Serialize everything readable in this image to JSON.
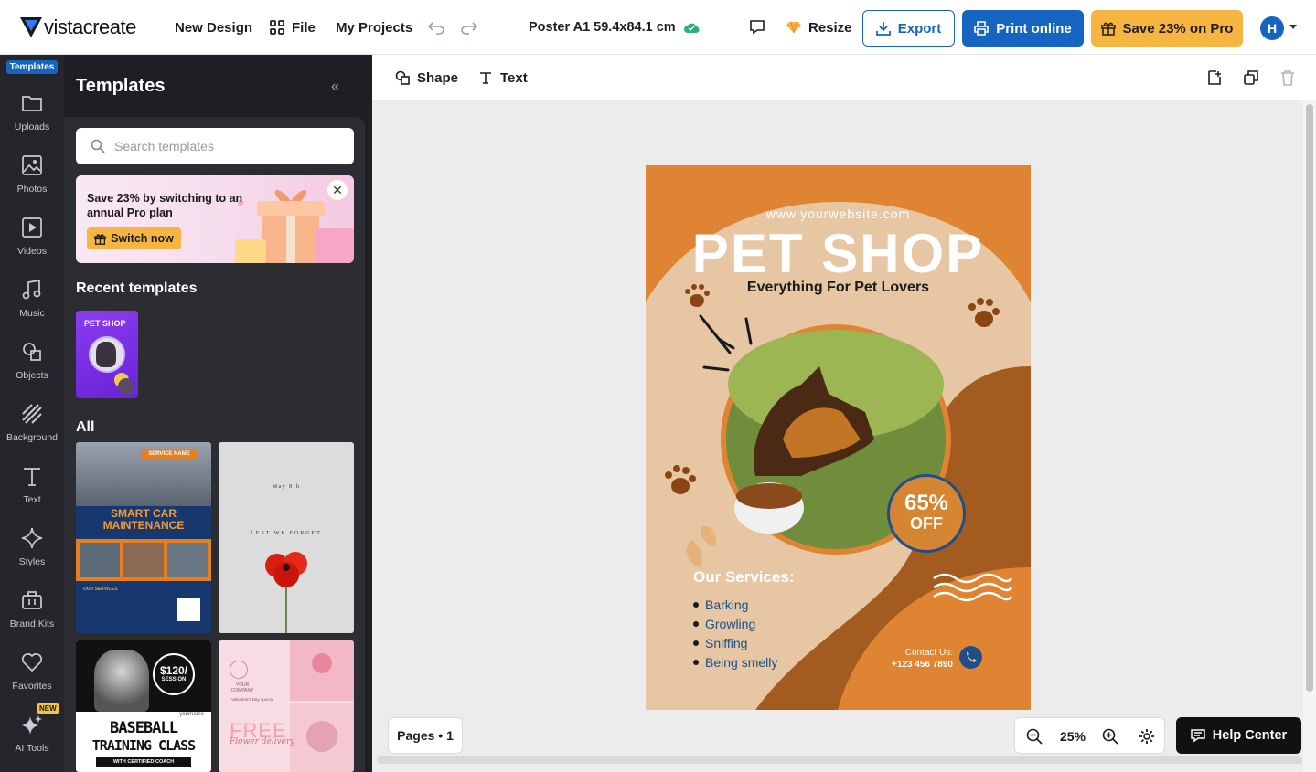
{
  "topbar": {
    "logo_text": "vistacreate",
    "new_design": "New Design",
    "file": "File",
    "my_projects": "My Projects",
    "doc_title": "Poster A1 59.4x84.1 cm",
    "resize": "Resize",
    "export": "Export",
    "print_online": "Print online",
    "save_pro": "Save 23% on Pro",
    "avatar_initial": "H"
  },
  "rail": {
    "active_tab": "Templates",
    "items": [
      "Uploads",
      "Photos",
      "Videos",
      "Music",
      "Objects",
      "Background",
      "Text",
      "Styles",
      "Brand Kits",
      "Favorites",
      "AI Tools"
    ],
    "new_badge": "NEW"
  },
  "panel": {
    "title": "Templates",
    "search_placeholder": "Search templates",
    "promo_text": "Save 23% by switching to an annual Pro plan",
    "promo_button": "Switch now",
    "recent_label": "Recent templates",
    "recent_thumb_title": "PET SHOP",
    "all_label": "All",
    "tpl_car": {
      "badge": "SERVICE NAME",
      "title_1": "SMART CAR",
      "title_2": "MAINTENANCE",
      "sub": "OUR SERVICES"
    },
    "tpl_poppy": {
      "date": "May 8th",
      "text": "LEST WE FORGET"
    },
    "tpl_baseball": {
      "price": "$120/",
      "price_sub": "SESSION",
      "name": "yourname",
      "title_1": "BASEBALL",
      "title_2": "TRAINING CLASS",
      "tagline": "WITH CERTIFIED COACH"
    },
    "tpl_flower": {
      "logo": "YOUR COMPANY",
      "title": "FREE",
      "sub": "Flower delivery",
      "note": "Valentine's Day special"
    }
  },
  "toolbar": {
    "shape": "Shape",
    "text": "Text"
  },
  "poster": {
    "url": "www.yourwebsite.com",
    "title": "PET SHOP",
    "subtitle": "Everything For Pet Lovers",
    "discount_1": "65%",
    "discount_2": "OFF",
    "services_title": "Our Services:",
    "services": [
      "Barking",
      "Growling",
      "Sniffing",
      "Being smelly"
    ],
    "contact_label": "Contact Us:",
    "contact_phone": "+123 456 7890"
  },
  "bottom": {
    "pages": "Pages • 1",
    "zoom": "25%",
    "help": "Help Center"
  },
  "colors": {
    "brand_blue": "#1565c0",
    "pro_orange": "#f6b440",
    "poster_orange": "#d68632",
    "poster_brown": "#a35b1f",
    "poster_beige": "#e7c6a4"
  }
}
